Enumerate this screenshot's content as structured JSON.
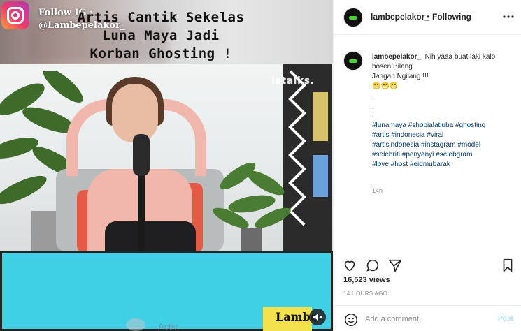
{
  "media": {
    "follow_line1": "Follow IG :",
    "follow_line2": "@Lambepelakor_",
    "video_watermark": "Istalks.",
    "caption_lines": [
      "Artis Cantik Sekelas",
      "Luna Maya Jadi",
      "Korban Ghosting !"
    ],
    "brand_text": "Lambe",
    "colors": {
      "caption_bg": "#3fd0e6",
      "brand_bg": "#f3e14c"
    }
  },
  "header": {
    "username": "lambepelakor_",
    "separator": "•",
    "follow_status": "Following"
  },
  "caption": {
    "username": "lambepelakor_",
    "line1": "Nih yaaa buat laki kalo",
    "line2": "bosen Bilang",
    "line3": "Jangan Ngilang !!!",
    "emoji": "😁😁😁",
    "dots": [
      ".",
      ".",
      "."
    ],
    "hashtag_lines": [
      "#lunamaya #shopialatjuba #ghosting",
      "#artis #indonesia #viral",
      "#artisindonesia #instagram #model",
      "#selebriti #penyanyi #selebgram",
      "#love #host #eidmubarak"
    ],
    "time_relative": "14h"
  },
  "actions": {
    "views": "16,523 views",
    "posted_ago": "14 HOURS AGO",
    "icons": [
      "heart-icon",
      "comment-icon",
      "share-icon",
      "bookmark-icon"
    ]
  },
  "comment": {
    "placeholder": "Add a comment...",
    "post_label": "Post"
  },
  "overlay": {
    "activate_text": "Activ"
  }
}
